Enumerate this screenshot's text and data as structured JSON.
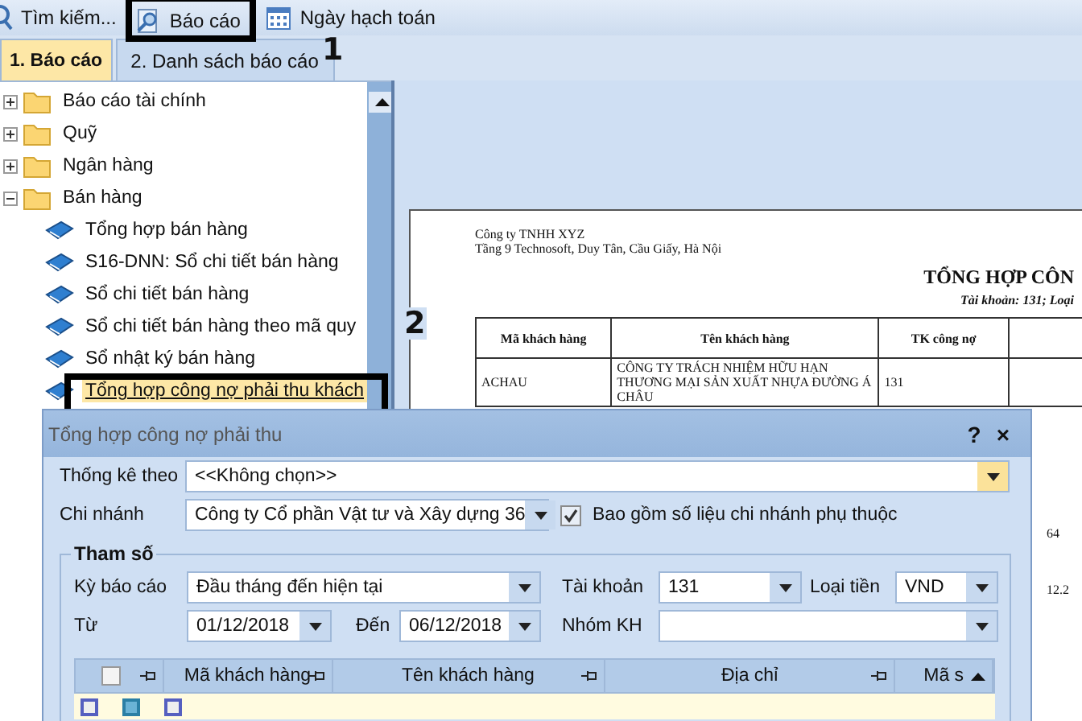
{
  "toolbar": [
    {
      "label": "Tìm kiếm...",
      "kind": "search"
    },
    {
      "label": "Báo cáo",
      "kind": "report"
    },
    {
      "label": "Ngày hạch toán",
      "kind": "calendar"
    }
  ],
  "tabs": [
    {
      "label": "1. Báo cáo",
      "selected": true
    },
    {
      "label": "2. Danh sách báo cáo",
      "selected": false
    }
  ],
  "tree": [
    {
      "label": "Báo cáo tài chính",
      "kind": "folder",
      "expanded": false,
      "selected": false
    },
    {
      "label": "Quỹ",
      "kind": "folder",
      "expanded": false,
      "selected": false
    },
    {
      "label": "Ngân hàng",
      "kind": "folder",
      "expanded": false,
      "selected": false
    },
    {
      "label": "Bán hàng",
      "kind": "folder",
      "expanded": true,
      "selected": false,
      "children": [
        {
          "label": "Tổng hợp bán hàng",
          "kind": "report",
          "selected": false
        },
        {
          "label": "S16-DNN: Sổ chi tiết bán hàng",
          "kind": "report",
          "selected": false
        },
        {
          "label": "Sổ chi tiết bán hàng",
          "kind": "report",
          "selected": false
        },
        {
          "label": "Sổ chi tiết bán hàng theo mã quy",
          "kind": "report",
          "selected": false
        },
        {
          "label": "Sổ nhật ký bán hàng",
          "kind": "report",
          "selected": false
        },
        {
          "label": "Tổng hợp công nợ phải thu khách",
          "kind": "report",
          "selected": true
        }
      ]
    }
  ],
  "report": {
    "company": "Công ty TNHH XYZ",
    "address": "Tầng 9 Technosoft, Duy Tân, Cầu Giấy, Hà Nội",
    "title": "TỔNG HỢP CÔN",
    "subtitle": "Tài khoản: 131; Loại",
    "columns": [
      "Mã khách hàng",
      "Tên khách hàng",
      "TK công nợ"
    ],
    "rows": [
      [
        "ACHAU",
        "CÔNG TY TRÁCH NHIỆM HỮU HẠN THƯƠNG MẠI SẢN XUẤT NHỰA ĐƯỜNG Á CHÂU",
        "131"
      ]
    ],
    "column_4_values": [
      "64",
      "12.2"
    ]
  },
  "callouts": [
    {
      "label": "1"
    },
    {
      "label": "2"
    }
  ],
  "dialog": {
    "title": "Tổng hợp công nợ phải thu",
    "help": "?",
    "close": "×",
    "statistic_by": {
      "label": "Thống kê theo",
      "value": "<<Không chọn>>",
      "focused": true
    },
    "branch": {
      "label": "Chi nhánh",
      "value": "Công ty Cổ phần Vật tư và Xây dựng 36",
      "focused": false
    },
    "include_dependent": {
      "label": "Bao gồm số liệu chi nhánh phụ thuộc",
      "checked": true
    },
    "parameters": {
      "title": "Tham số",
      "report_period": {
        "label": "Kỳ báo cáo",
        "value": "Đầu tháng đến hiện tại",
        "focused": false
      },
      "account": {
        "label": "Tài khoản",
        "value": "131",
        "focused": false
      },
      "currency": {
        "label": "Loại tiền",
        "value": "VND",
        "focused": false
      },
      "from": {
        "label": "Từ",
        "value": "01/12/2018",
        "focused": false
      },
      "to": {
        "label": "Đến",
        "value": "06/12/2018",
        "focused": false
      },
      "customer_group": {
        "label": "Nhóm KH",
        "focused": false
      }
    },
    "grid": {
      "select_all_checked": false,
      "columns": [
        "Mã khách hàng",
        "Tên khách hàng",
        "Địa chỉ",
        "Mã s"
      ]
    }
  }
}
